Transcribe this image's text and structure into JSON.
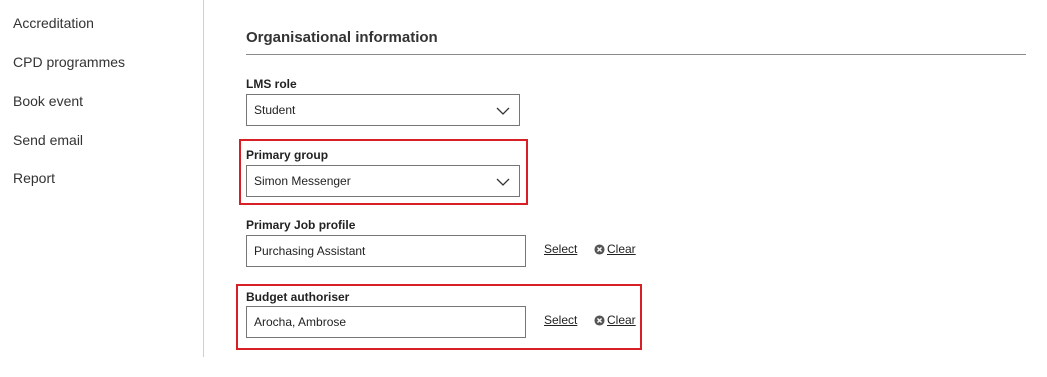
{
  "sidebar": {
    "items": [
      {
        "label": "Accreditation"
      },
      {
        "label": "CPD programmes"
      },
      {
        "label": "Book event"
      },
      {
        "label": "Send email"
      },
      {
        "label": "Report"
      }
    ]
  },
  "section": {
    "title": "Organisational information"
  },
  "fields": {
    "lms_role": {
      "label": "LMS role",
      "value": "Student"
    },
    "primary_group": {
      "label": "Primary group",
      "value": "Simon Messenger"
    },
    "primary_job_profile": {
      "label": "Primary Job profile",
      "value": "Purchasing Assistant",
      "select_label": "Select",
      "clear_label": "Clear"
    },
    "budget_authoriser": {
      "label": "Budget authoriser",
      "value": "Arocha, Ambrose",
      "select_label": "Select",
      "clear_label": "Clear"
    }
  },
  "colors": {
    "highlight": "#d81f26",
    "text": "#2b2b2b",
    "border": "#767676"
  }
}
